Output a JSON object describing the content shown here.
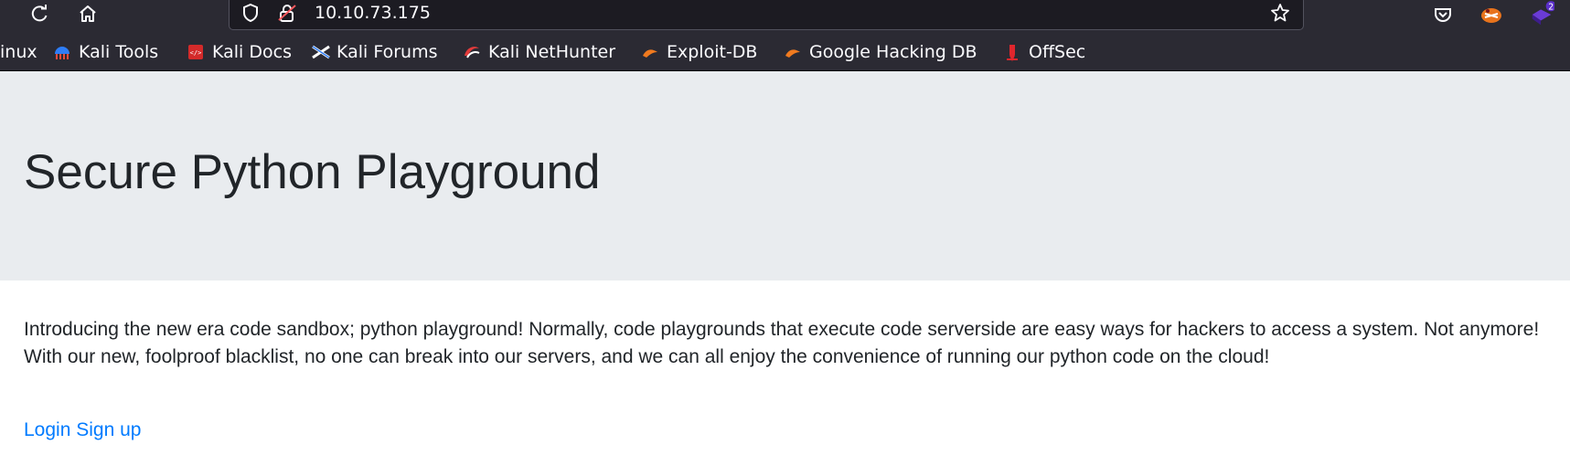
{
  "browser": {
    "url": "10.10.73.175",
    "extension_badge": "2",
    "bookmarks": [
      {
        "label": "inux",
        "icon": "kali-linux-icon"
      },
      {
        "label": "Kali Tools",
        "icon": "kali-tools-icon"
      },
      {
        "label": "Kali Docs",
        "icon": "kali-docs-icon"
      },
      {
        "label": "Kali Forums",
        "icon": "kali-forums-icon"
      },
      {
        "label": "Kali NetHunter",
        "icon": "kali-nethunter-icon"
      },
      {
        "label": "Exploit-DB",
        "icon": "exploit-db-icon"
      },
      {
        "label": "Google Hacking DB",
        "icon": "google-hacking-db-icon"
      },
      {
        "label": "OffSec",
        "icon": "offsec-icon"
      }
    ],
    "colors": {
      "chrome": "#2b2a33",
      "urlbar": "#1c1b22"
    }
  },
  "page": {
    "title": "Secure Python Playground",
    "intro": "Introducing the new era code sandbox; python playground! Normally, code playgrounds that execute code serverside are easy ways for hackers to access a system. Not anymore! With our new, foolproof blacklist, no one can break into our servers, and we can all enjoy the convenience of running our python code on the cloud!",
    "login_label": "Login",
    "signup_label": "Sign up",
    "colors": {
      "jumbotron": "#e9ecef",
      "link": "#007bff",
      "text": "#212529"
    }
  }
}
